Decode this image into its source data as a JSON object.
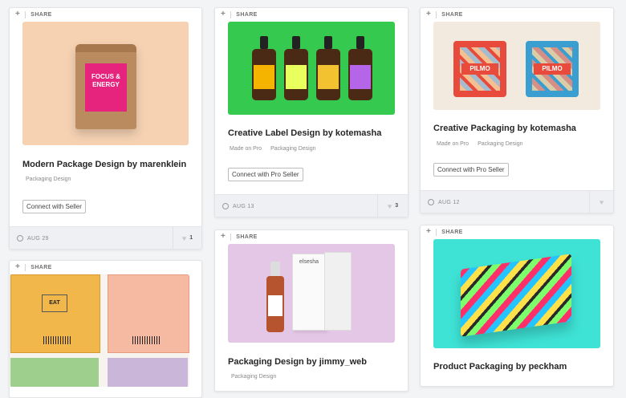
{
  "share_label": "SHARE",
  "cards": [
    {
      "title": "Modern Package Design by marenklein",
      "tags": [
        "Packaging Design"
      ],
      "button": "Connect with Seller",
      "date": "AUG 29",
      "likes": "1",
      "art": {
        "text1": "FOCUS &",
        "text2": "ENERGY"
      }
    },
    {
      "title": "Creative Label Design by kotemasha",
      "tags": [
        "Made on Pro",
        "Packaging Design"
      ],
      "button": "Connect with Pro Seller",
      "date": "AUG 13",
      "likes": "3"
    },
    {
      "title": "Creative Packaging by kotemasha",
      "tags": [
        "Made on Pro",
        "Packaging Design"
      ],
      "button": "Connect with Pro Seller",
      "date": "AUG 12",
      "likes": "",
      "art": {
        "brand": "PILMO"
      }
    },
    {
      "title": "",
      "tags": [],
      "art": {
        "label": "EAT"
      }
    },
    {
      "title": "Packaging Design by jimmy_web",
      "tags": [
        "Packaging Design"
      ],
      "art": {
        "brand": "elsesha"
      }
    },
    {
      "title": "Product Packaging by peckham",
      "tags": []
    }
  ]
}
